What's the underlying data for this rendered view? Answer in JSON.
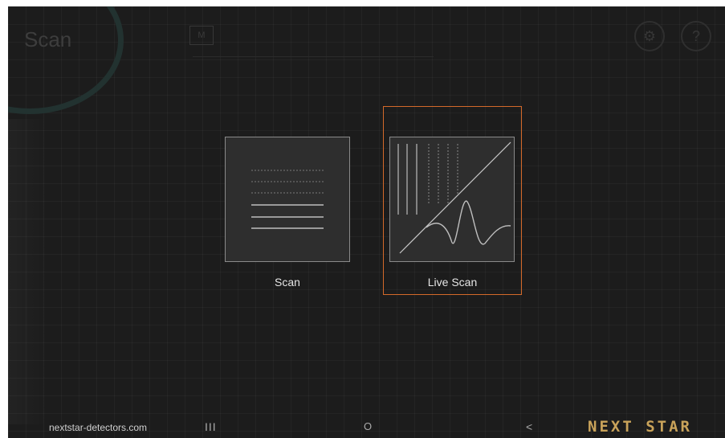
{
  "background": {
    "title": "Scan",
    "subtitle": "",
    "mode_icon": "mode-icon",
    "icons": [
      "settings-icon",
      "help-icon"
    ]
  },
  "menu": {
    "items": [
      {
        "id": "scan",
        "label": "Scan",
        "icon": "scan-lines-icon",
        "selected": false
      },
      {
        "id": "live",
        "label": "Live Scan",
        "icon": "live-scan-graph-icon",
        "selected": true
      }
    ]
  },
  "navbar": {
    "url": "nextstar-detectors.com",
    "recents": "III",
    "home": "O",
    "back": "<",
    "brand": "NEXT STAR"
  },
  "colors": {
    "screen_bg": "#1c1c1c",
    "selection": "#d3692a",
    "brand": "#c9a35a"
  }
}
